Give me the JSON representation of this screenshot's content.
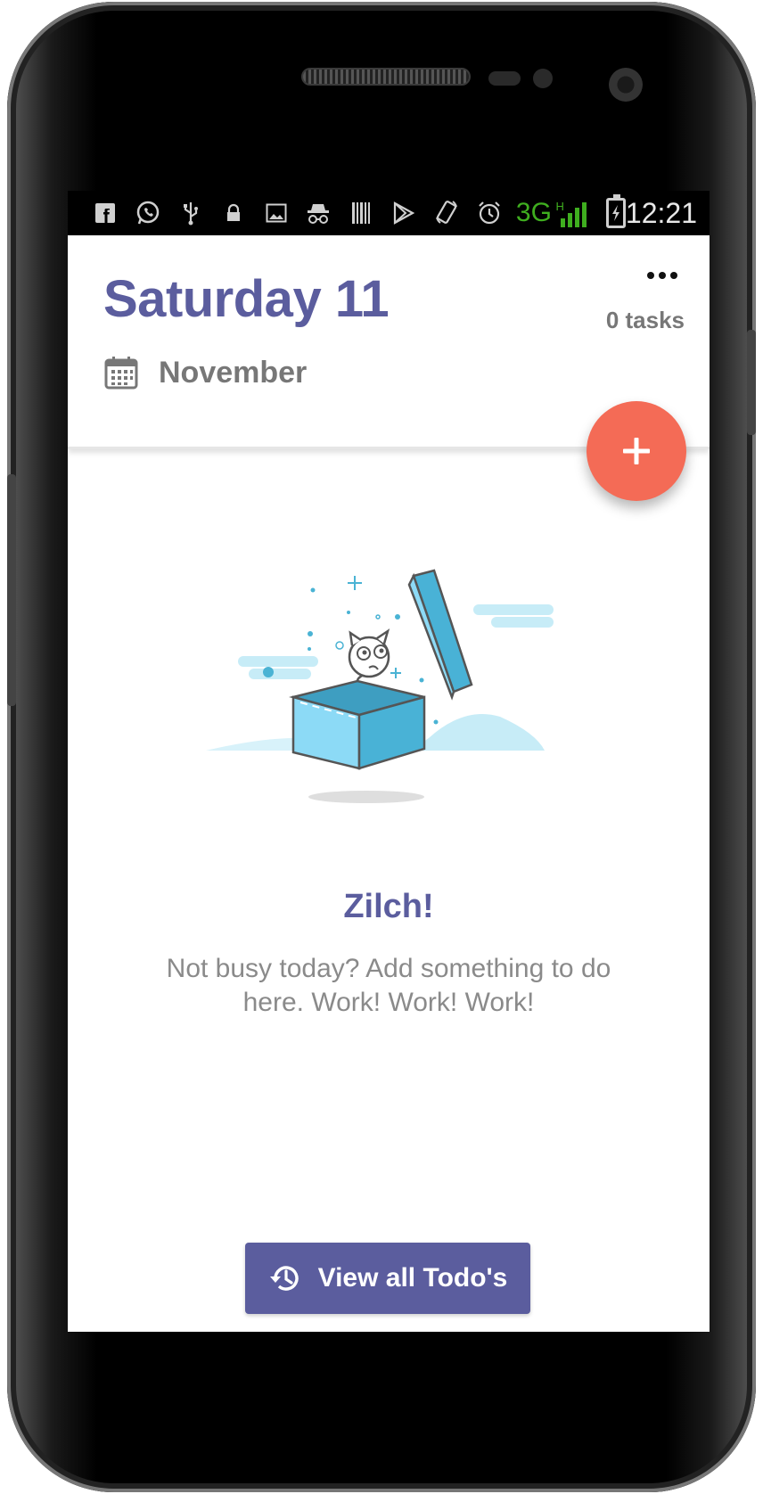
{
  "status_bar": {
    "network_type": "3G",
    "network_sub": "H",
    "time": "12:21",
    "icons": [
      "facebook-icon",
      "whatsapp-icon",
      "usb-icon",
      "lock-icon",
      "image-icon",
      "incognito-icon",
      "barcode-icon",
      "play-store-icon",
      "screen-rotation-icon",
      "alarm-icon",
      "signal-icon",
      "battery-charging-icon"
    ]
  },
  "header": {
    "date_title": "Saturday 11",
    "month": "November",
    "task_count": "0 tasks",
    "calendar_icon": "calendar-icon",
    "more_icon": "more-horizontal-icon"
  },
  "fab": {
    "icon": "plus-icon",
    "color": "#f46b56"
  },
  "empty_state": {
    "title": "Zilch!",
    "message": "Not busy today? Add something to do here. Work! Work! Work!",
    "illustration": "empty-box-illustration"
  },
  "footer": {
    "button_label": "View all Todo's",
    "button_icon": "history-icon"
  },
  "colors": {
    "accent": "#5b5d9e",
    "fab": "#f46b56",
    "muted_text": "#777777"
  }
}
